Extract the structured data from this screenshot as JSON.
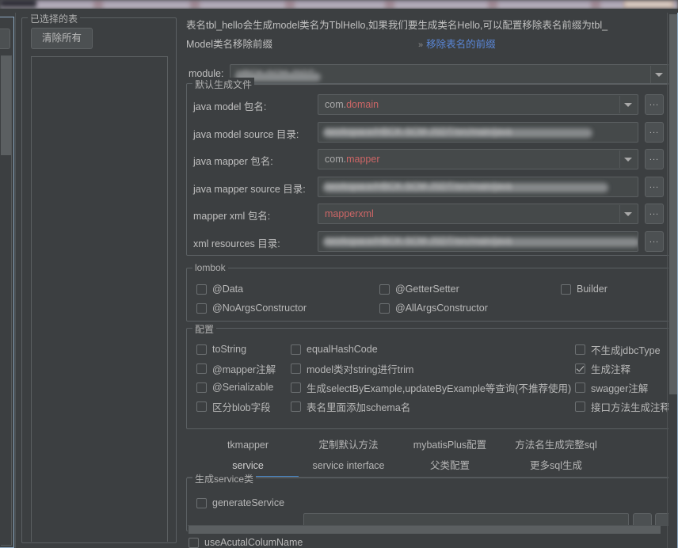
{
  "window": {
    "title_bar_blurred": true
  },
  "left_panel": {
    "group_title": "已选择的表",
    "clear_all_label": "清除所有"
  },
  "main": {
    "hint": "表名tbl_hello会生成model类名为TblHello,如果我们要生成类名Hello,可以配置移除表名前缀为tbl_",
    "prefix_label": "Model类名移除前缀",
    "prefix_link": "移除表名的前缀",
    "prefix_link_chevron": "»",
    "module": {
      "label": "module:",
      "value_redacted": "HBCK-SCM-JSDT",
      "redacted": true
    },
    "generated_files": {
      "group_title": "默认生成文件",
      "rows": [
        {
          "label": "java model 包名:",
          "value_prefix": "com.",
          "value_accent": "domain",
          "combo": true,
          "redacted": false,
          "dots": "..."
        },
        {
          "label": "java model source 目录:",
          "value_prefix": "",
          "value_accent": "",
          "combo": false,
          "redacted": true,
          "dots": "..."
        },
        {
          "label": "java mapper 包名:",
          "value_prefix": "com.",
          "value_accent": "mapper",
          "combo": true,
          "redacted": false,
          "dots": "..."
        },
        {
          "label": "java mapper source 目录:",
          "value_prefix": "",
          "value_accent": "",
          "combo": false,
          "redacted": true,
          "dots": "..."
        },
        {
          "label": "mapper xml 包名:",
          "value_prefix": "",
          "value_accent": "mapperxml",
          "combo": true,
          "redacted": false,
          "dots": "..."
        },
        {
          "label": "xml resources 目录:",
          "value_prefix": "",
          "value_accent": "",
          "combo": false,
          "redacted": true,
          "dots": "..."
        }
      ]
    },
    "lombok": {
      "group_title": "lombok",
      "checkboxes": [
        {
          "label": "@Data",
          "checked": false,
          "col": 0,
          "row": 0
        },
        {
          "label": "@GetterSetter",
          "checked": false,
          "col": 1,
          "row": 0
        },
        {
          "label": "Builder",
          "checked": false,
          "col": 2,
          "row": 0
        },
        {
          "label": "@NoArgsConstructor",
          "checked": false,
          "col": 0,
          "row": 1
        },
        {
          "label": "@AllArgsConstructor",
          "checked": false,
          "col": 1,
          "row": 1
        }
      ]
    },
    "config": {
      "group_title": "配置",
      "checkboxes": [
        {
          "label": "toString",
          "checked": false,
          "col": 0,
          "row": 0
        },
        {
          "label": "equalHashCode",
          "checked": false,
          "col": 1,
          "row": 0
        },
        {
          "label": "不生成jdbcType",
          "checked": false,
          "col": 2,
          "row": 0
        },
        {
          "label": "@mapper注解",
          "checked": false,
          "col": 0,
          "row": 1
        },
        {
          "label": "model类对string进行trim",
          "checked": false,
          "col": 1,
          "row": 1
        },
        {
          "label": "生成注释",
          "checked": true,
          "col": 2,
          "row": 1
        },
        {
          "label": "@Serializable",
          "checked": false,
          "col": 0,
          "row": 2
        },
        {
          "label": "生成selectByExample,updateByExample等查询(不推荐使用)",
          "checked": false,
          "col": 1,
          "row": 2
        },
        {
          "label": "swagger注解",
          "checked": false,
          "col": 2,
          "row": 2
        },
        {
          "label": "区分blob字段",
          "checked": false,
          "col": 0,
          "row": 3
        },
        {
          "label": "表名里面添加schema名",
          "checked": false,
          "col": 1,
          "row": 3
        },
        {
          "label": "接口方法生成注释",
          "checked": false,
          "col": 2,
          "row": 3
        }
      ]
    },
    "tabs": {
      "row1": [
        {
          "label": "tkmapper",
          "selected": false
        },
        {
          "label": "定制默认方法",
          "selected": false
        },
        {
          "label": "mybatisPlus配置",
          "selected": false
        },
        {
          "label": "方法名生成完整sql",
          "selected": false
        }
      ],
      "row2": [
        {
          "label": "service",
          "selected": true
        },
        {
          "label": "service interface",
          "selected": false
        },
        {
          "label": "父类配置",
          "selected": false
        },
        {
          "label": "更多sql生成",
          "selected": false
        }
      ]
    },
    "service_panel": {
      "group_title": "生成service类",
      "generate_service_label": "generateService",
      "generate_service_checked": false
    },
    "bottom": {
      "use_actual_column_name_label": "useAcutalColumName",
      "use_actual_column_name_checked": false
    }
  },
  "colors": {
    "background": "#3c3f41",
    "panel_border": "#5b6063",
    "focus_border": "#8fabc4",
    "accent_link": "#5a87d8",
    "accent_value": "#cc6666",
    "tab_underline": "#4a88c7",
    "text": "#bbbbbb",
    "input_bg": "#45494a",
    "scrollbar_thumb": "#5b5f61"
  }
}
